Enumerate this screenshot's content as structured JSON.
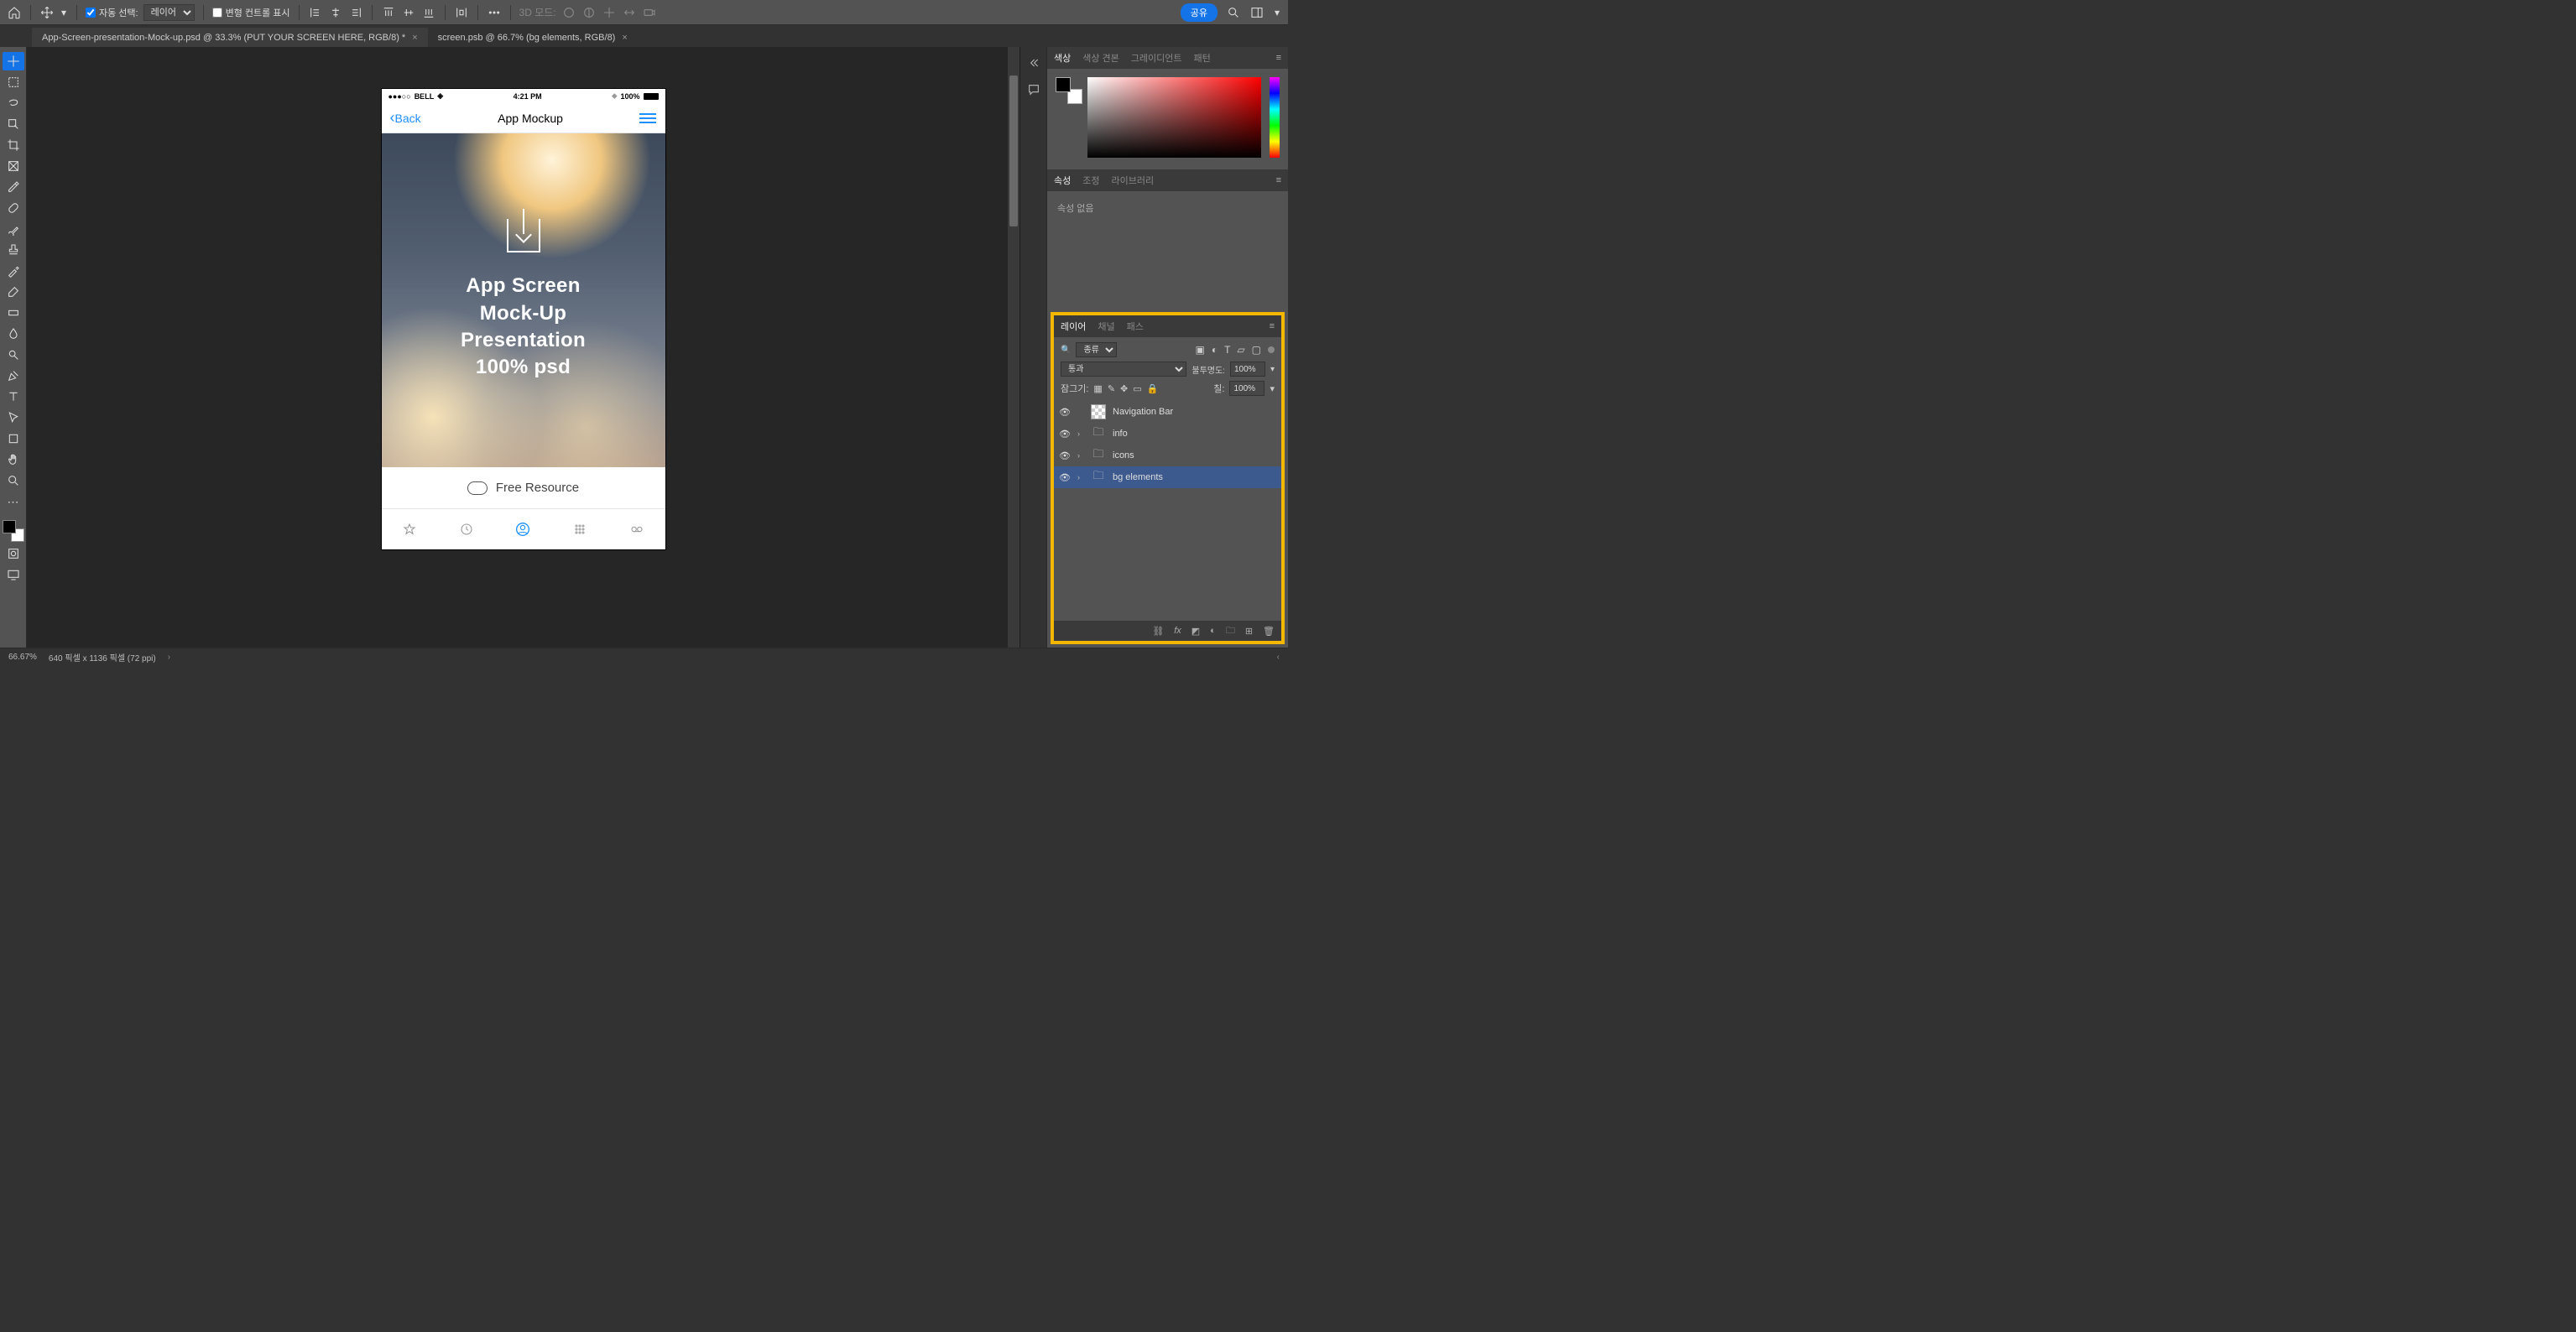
{
  "topbar": {
    "auto_select_label": "자동 선택:",
    "auto_select_value": "레이어",
    "transform_controls": "변형 컨트롤 표시",
    "mode3d_label": "3D 모드:",
    "share": "공유"
  },
  "tabs": [
    {
      "label": "App-Screen-presentation-Mock-up.psd @ 33.3% (PUT YOUR SCREEN HERE, RGB/8) *",
      "active": false
    },
    {
      "label": "screen.psb @ 66.7% (bg elements, RGB/8)",
      "active": true
    }
  ],
  "phone": {
    "carrier": "BELL",
    "time": "4:21 PM",
    "battery": "100%",
    "back": "Back",
    "title": "App Mockup",
    "hero_l1": "App Screen",
    "hero_l2": "Mock-Up",
    "hero_l3": "Presentation",
    "hero_l4": "100% psd",
    "free": "Free Resource"
  },
  "panels": {
    "color_tabs": {
      "c": "색상",
      "s": "색상 견본",
      "g": "그레이디언트",
      "p": "패턴"
    },
    "props_tabs": {
      "a": "속성",
      "b": "조정",
      "c": "라이브러리"
    },
    "props_empty": "속성 없음",
    "layer_tabs": {
      "a": "레이어",
      "b": "채널",
      "c": "패스"
    },
    "filter_label": "종류",
    "blend_label": "통과",
    "opacity_label": "불투명도:",
    "opacity_value": "100%",
    "lock_label": "잠그기:",
    "fill_label": "칠:",
    "fill_value": "100%"
  },
  "layers": [
    {
      "name": "Navigation Bar",
      "type": "layer",
      "selected": false
    },
    {
      "name": "info",
      "type": "folder",
      "selected": false
    },
    {
      "name": "icons",
      "type": "folder",
      "selected": false
    },
    {
      "name": "bg elements",
      "type": "folder",
      "selected": true
    }
  ],
  "status": {
    "zoom": "66.67%",
    "dims": "640 픽셀 x 1136 픽셀 (72 ppi)"
  }
}
